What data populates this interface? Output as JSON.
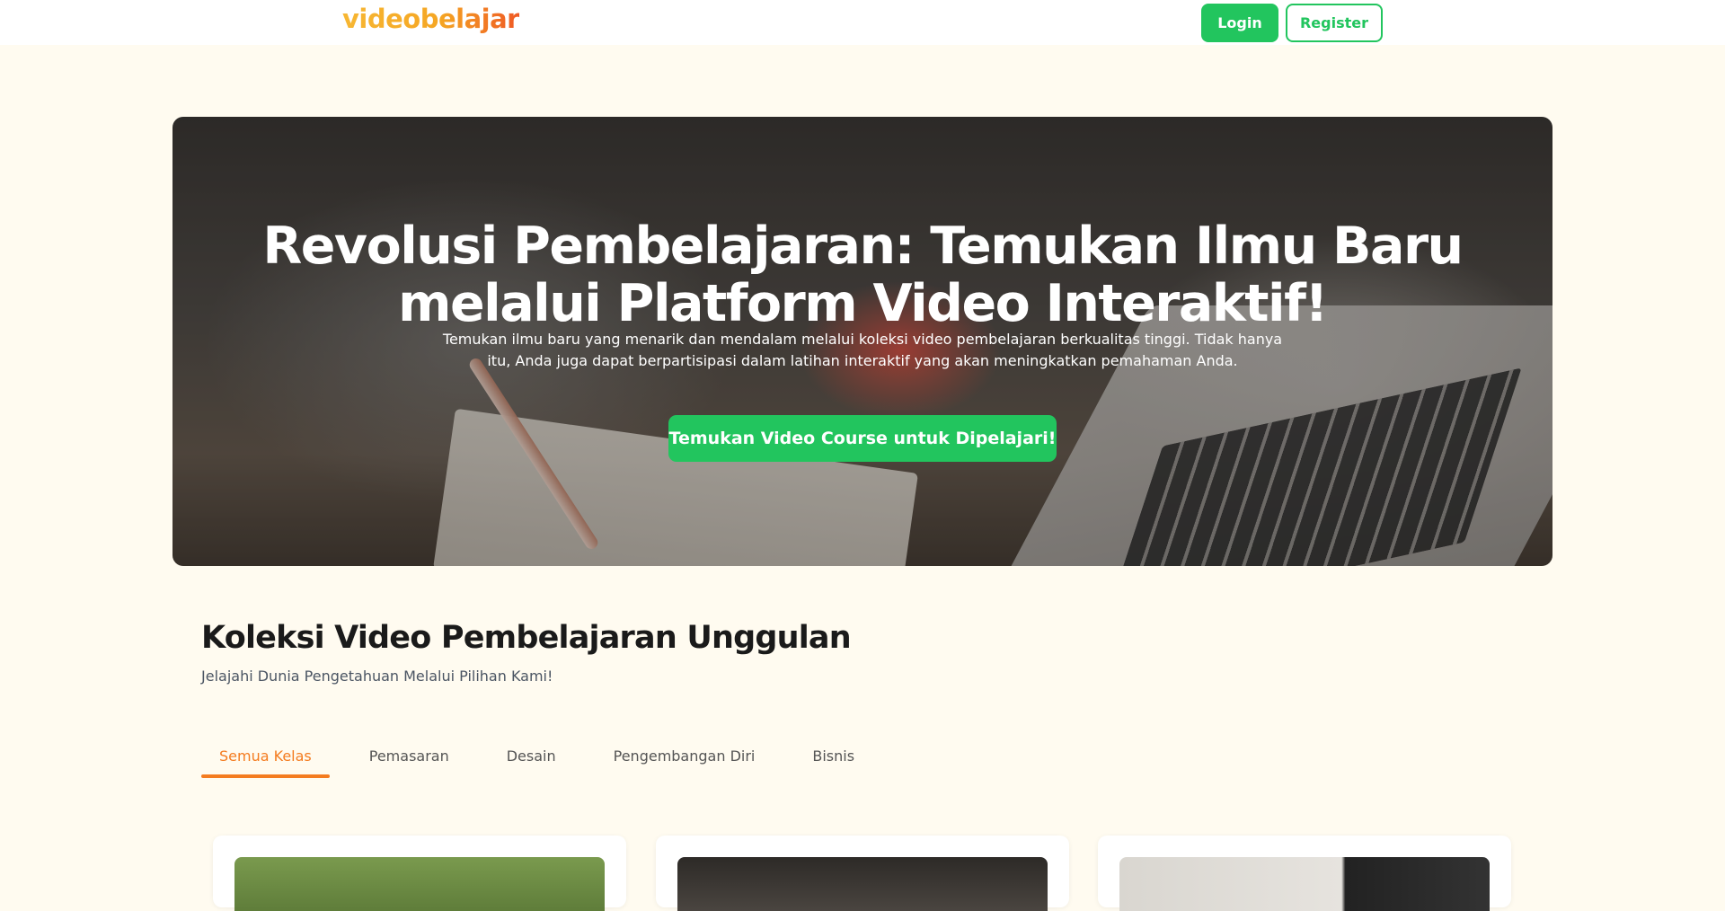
{
  "header": {
    "logo": "videobelajar",
    "login_label": "Login",
    "register_label": "Register"
  },
  "hero": {
    "title": "Revolusi Pembelajaran: Temukan Ilmu Baru melalui Platform Video Interaktif!",
    "description": "Temukan ilmu baru yang menarik dan mendalam melalui koleksi video pembelajaran berkualitas tinggi. Tidak hanya itu, Anda juga dapat berpartisipasi dalam latihan interaktif yang akan meningkatkan pemahaman Anda.",
    "cta_label": "Temukan Video Course untuk Dipelajari!"
  },
  "collection": {
    "title": "Koleksi Video Pembelajaran Unggulan",
    "subtitle": "Jelajahi Dunia Pengetahuan Melalui Pilihan Kami!",
    "tabs": [
      {
        "label": "Semua Kelas",
        "active": true
      },
      {
        "label": "Pemasaran",
        "active": false
      },
      {
        "label": "Desain",
        "active": false
      },
      {
        "label": "Pengembangan Diri",
        "active": false
      },
      {
        "label": "Bisnis",
        "active": false
      }
    ]
  },
  "colors": {
    "accent_green": "#22c55e",
    "accent_orange": "#f47c20",
    "page_background": "#fffbf0"
  }
}
